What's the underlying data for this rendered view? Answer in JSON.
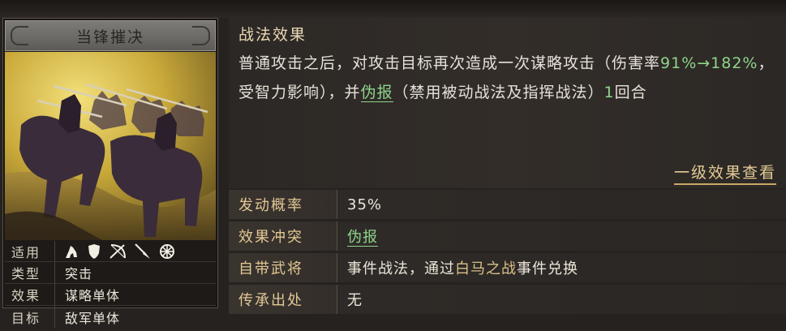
{
  "card": {
    "title": "当锋摧决",
    "info": {
      "applicable_label": "适用",
      "applicable_icons": [
        "cavalry-icon",
        "shield-icon",
        "bow-icon",
        "spear-icon",
        "siege-wheel-icon"
      ],
      "type_label": "类型",
      "type_value": "突击",
      "effect_label": "效果",
      "effect_value": "谋略单体",
      "target_label": "目标",
      "target_value": "敌军单体"
    }
  },
  "effect": {
    "header": "战法效果",
    "text_1": "普通攻击之后，对攻击目标再次造成一次谋略攻击（伤害率",
    "rate": "91%→182%",
    "text_2": "，受智力影响），并",
    "status_link": "伪报",
    "text_3": "（禁用被动战法及指挥战法）",
    "rounds": "1",
    "text_4": "回合",
    "view_level_one": "一级效果查看"
  },
  "attributes": {
    "trigger_label": "发动概率",
    "trigger_value": "35%",
    "conflict_label": "效果冲突",
    "conflict_value": "伪报",
    "general_label": "自带武将",
    "general_pre": "事件战法，通过",
    "general_event": "白马之战",
    "general_post": "事件兑换",
    "inherit_label": "传承出处",
    "inherit_value": "无"
  },
  "colors": {
    "green": "#8fd48b",
    "gold": "#e2c895",
    "event": "#d9c089"
  }
}
